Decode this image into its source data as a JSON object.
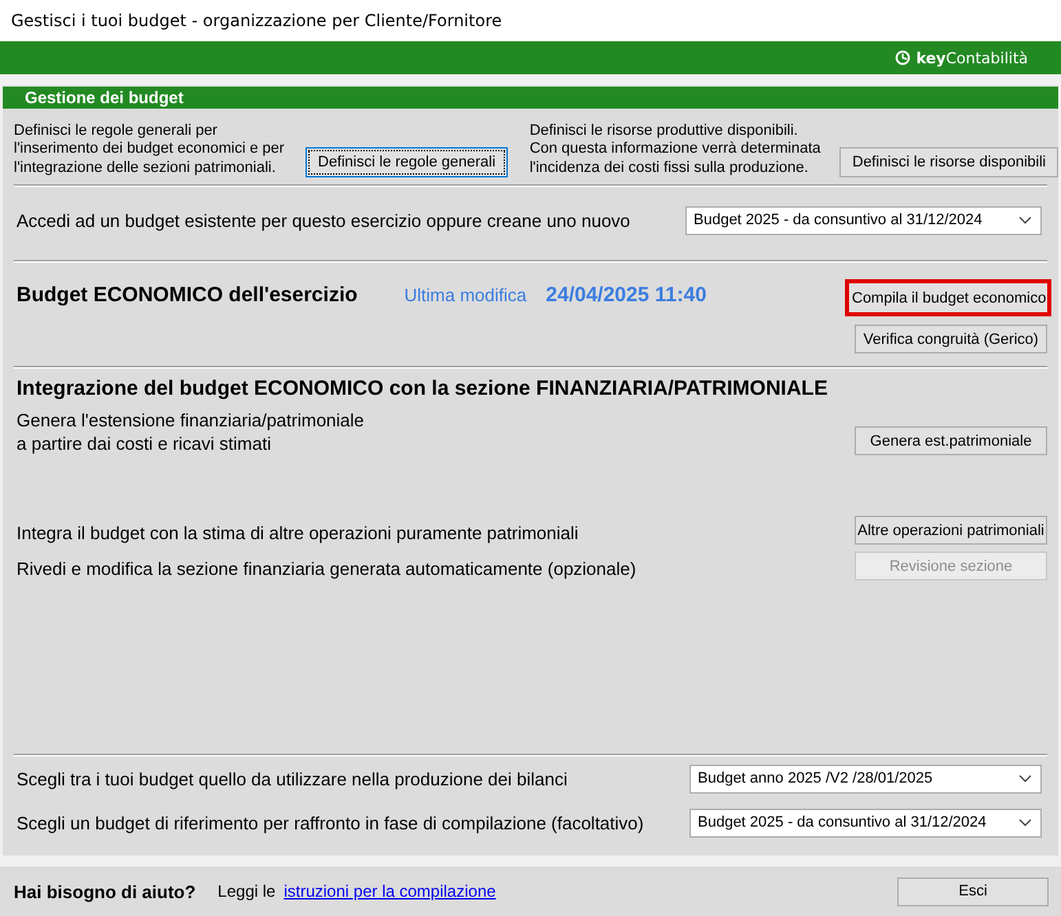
{
  "window": {
    "title": "Gestisci i tuoi budget - organizzazione per Cliente/Fornitore"
  },
  "brand": {
    "bold": "key",
    "text": "Contabilità"
  },
  "panel": {
    "title": "Gestione dei budget"
  },
  "setup": [
    {
      "lines": [
        "Definisci le regole generali per",
        "l'inserimento dei budget economici e per",
        "l'integrazione delle sezioni patrimoniali."
      ],
      "button": {
        "label": "Definisci le regole generali",
        "focused": true,
        "disabled": false
      }
    },
    {
      "lines": [
        "Definisci le risorse produttive disponibili.",
        "Con questa informazione verrà determinata",
        "l'incidenza dei costi fissi sulla produzione."
      ],
      "button": {
        "label": "Definisci le risorse disponibili",
        "focused": false,
        "disabled": false
      }
    }
  ],
  "access": {
    "label": "Accedi ad un budget esistente per questo esercizio oppure creane uno nuovo",
    "value": "Budget 2025 - da consuntivo al 31/12/2024"
  },
  "economic": {
    "title": "Budget ECONOMICO dell'esercizio",
    "modified_label": "Ultima modifica",
    "modified_at": "24/04/2025 11:40",
    "buttons": [
      {
        "label": "Compila il budget economico",
        "highlighted": true,
        "disabled": false
      },
      {
        "label": "Verifica congruità (Gerico)",
        "highlighted": false,
        "disabled": false
      }
    ]
  },
  "integration": {
    "title": "Integrazione del budget ECONOMICO con la sezione FINANZIARIA/PATRIMONIALE",
    "rows": [
      {
        "lines": [
          "Genera l'estensione finanziaria/patrimoniale",
          "a partire dai costi e ricavi stimati"
        ],
        "button": {
          "label": "Genera est.patrimoniale",
          "disabled": false
        }
      },
      {
        "lines": [
          "Integra il budget con la stima di altre operazioni puramente patrimoniali"
        ],
        "button": {
          "label": "Altre operazioni patrimoniali",
          "disabled": false
        }
      },
      {
        "lines": [
          "Rivedi e modifica la sezione finanziaria generata automaticamente (opzionale)"
        ],
        "button": {
          "label": "Revisione sezione",
          "disabled": true
        }
      }
    ]
  },
  "choices": [
    {
      "label": "Scegli tra i tuoi budget quello da utilizzare nella produzione dei bilanci",
      "value": "Budget anno 2025 /V2 /28/01/2025"
    },
    {
      "label": "Scegli un budget di riferimento per raffronto in fase di compilazione (facoltativo)",
      "value": "Budget 2025 - da consuntivo al 31/12/2024"
    }
  ],
  "footer": {
    "help": "Hai bisogno di aiuto?",
    "prefix": "Leggi le",
    "link": "istruzioni per la compilazione",
    "button": {
      "label": "Esci",
      "disabled": false
    }
  }
}
